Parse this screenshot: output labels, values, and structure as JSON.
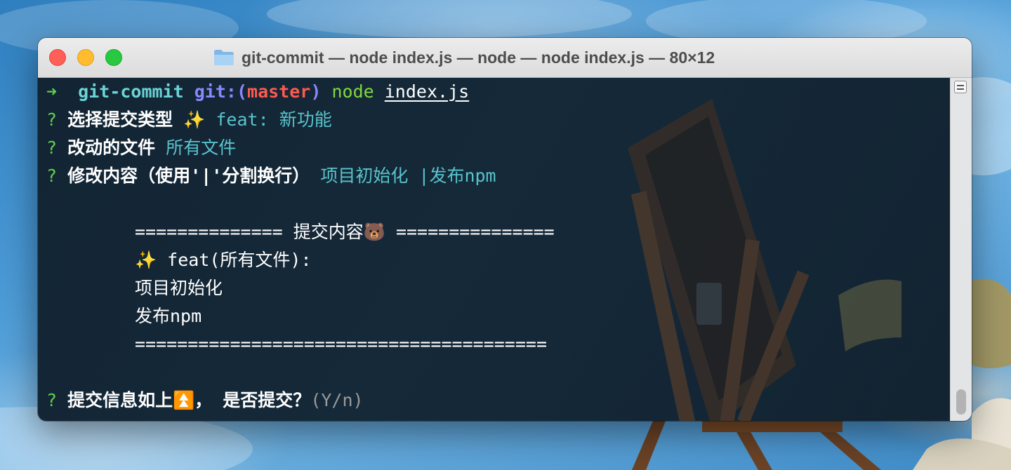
{
  "window": {
    "title": "git-commit — node index.js — node — node index.js — 80×12"
  },
  "colors": {
    "prompt_arrow": "#60d04a",
    "directory": "#6ad4d6",
    "git_label": "#8b88ff",
    "branch": "#ff5a4e",
    "answer": "#58c4cc",
    "hint": "#9a9a9a"
  },
  "terminal": {
    "command": {
      "arrow": "➜",
      "directory": "git-commit",
      "git": "git:",
      "paren_open": "(",
      "branch": "master",
      "paren_close": ")",
      "program": "node",
      "file": "index.js"
    },
    "q1": {
      "mark": "?",
      "question": "选择提交类型",
      "answer": "✨ feat: 新功能"
    },
    "q2": {
      "mark": "?",
      "question": "改动的文件",
      "answer": "所有文件"
    },
    "q3": {
      "mark": "?",
      "question": "修改内容（使用'|'分割换行）",
      "answer": "项目初始化 |发布npm"
    },
    "summary": {
      "header": "============== 提交内容🐻 ===============",
      "line1": "✨ feat(所有文件):",
      "line2": "项目初始化",
      "line3": "发布npm",
      "footer": "======================================="
    },
    "q4": {
      "mark": "?",
      "question": "提交信息如上⏫， 是否提交？",
      "hint": "(Y/n)"
    }
  }
}
